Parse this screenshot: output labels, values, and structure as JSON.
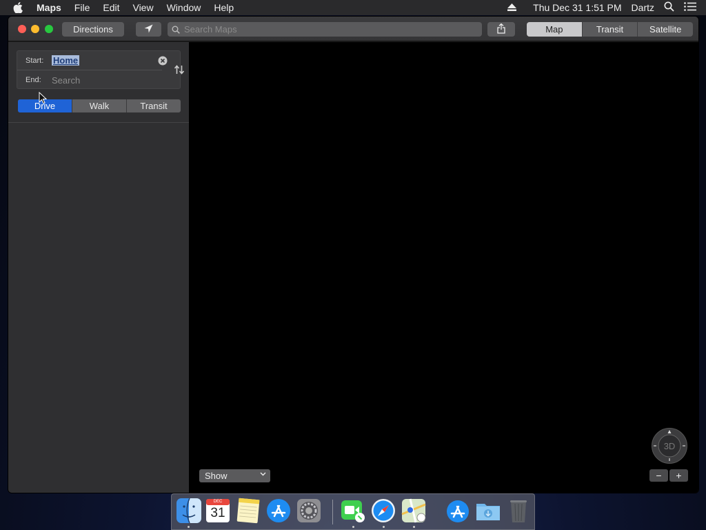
{
  "menubar": {
    "app_name": "Maps",
    "items": [
      "File",
      "Edit",
      "View",
      "Window",
      "Help"
    ],
    "datetime": "Thu Dec 31  1:51 PM",
    "user": "Dartz"
  },
  "toolbar": {
    "directions_label": "Directions",
    "search_placeholder": "Search Maps",
    "map_modes": [
      "Map",
      "Transit",
      "Satellite"
    ],
    "active_map_mode": "Map"
  },
  "directions": {
    "start_label": "Start:",
    "start_value": "Home",
    "end_label": "End:",
    "end_placeholder": "Search",
    "modes": [
      "Drive",
      "Walk",
      "Transit"
    ],
    "active_mode": "Drive"
  },
  "map": {
    "show_label": "Show",
    "compass_label": "3D",
    "zoom_out": "−",
    "zoom_in": "+"
  },
  "dock": {
    "calendar_month": "DEC",
    "calendar_day": "31",
    "apps": [
      "finder-icon",
      "calendar-icon",
      "notes-icon",
      "app-store-icon",
      "system-preferences-icon",
      "facetime-icon",
      "safari-icon",
      "maps-icon",
      "app-store-downloads-icon",
      "downloads-folder-icon",
      "trash-icon"
    ]
  }
}
